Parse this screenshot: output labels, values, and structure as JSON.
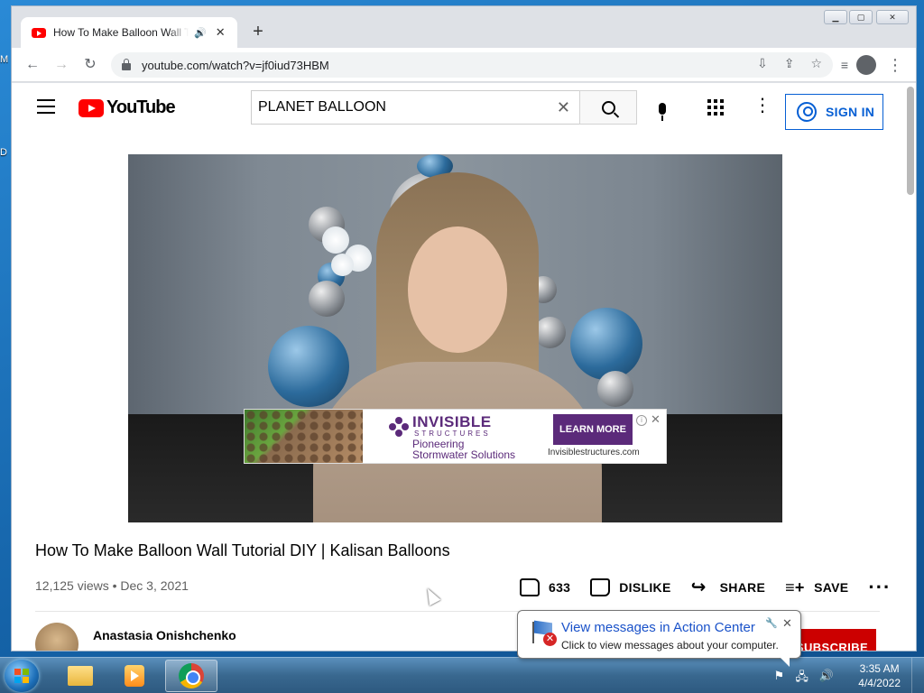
{
  "desktop": {
    "sliver_top": "M",
    "sliver_mid": "D"
  },
  "browser": {
    "tab_title": "How To Make Balloon Wall Tutorial DIY | Kalisan Balloons",
    "url": "youtube.com/watch?v=jf0iud73HBM"
  },
  "youtube": {
    "logo_text": "YouTube",
    "search_query": "PLANET BALLOON",
    "sign_in_label": "SIGN IN"
  },
  "ad": {
    "brand": "INVISIBLE",
    "brand_sub": "STRUCTURES",
    "tagline_1": "Pioneering",
    "tagline_2": "Stormwater Solutions",
    "cta": "LEARN MORE",
    "url": "Invisiblestructures.com"
  },
  "video": {
    "title": "How To Make Balloon Wall Tutorial DIY | Kalisan Balloons",
    "meta": "12,125 views • Dec 3, 2021",
    "likes": "633",
    "dislike_label": "DISLIKE",
    "share_label": "SHARE",
    "save_label": "SAVE",
    "channel_name": "Anastasia Onishchenko",
    "subscribe_label": "SUBSCRIBE"
  },
  "notification": {
    "title": "View messages in Action Center",
    "body": "Click to view messages about your computer."
  },
  "taskbar": {
    "time": "3:35 AM",
    "date": "4/4/2022"
  },
  "colors": {
    "youtube_red": "#ff0000",
    "link_blue": "#065fd4",
    "ad_purple": "#5b2a7a",
    "taskbar": "#39688f"
  }
}
